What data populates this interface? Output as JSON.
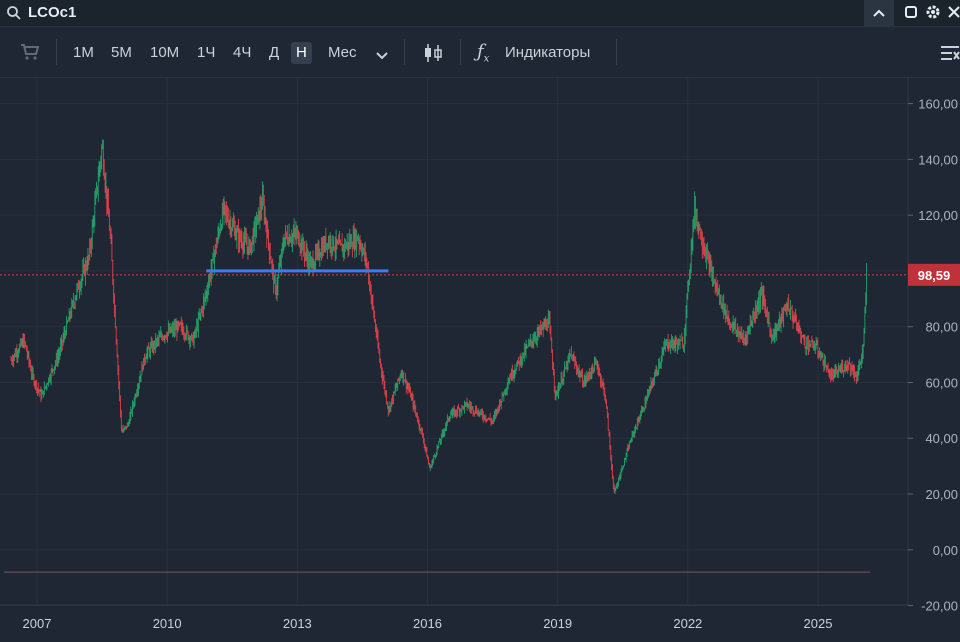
{
  "header": {
    "symbol": "LCOc1"
  },
  "toolbar": {
    "intervals": [
      "1М",
      "5М",
      "10М",
      "1Ч",
      "4Ч",
      "Д",
      "Н",
      "Мес"
    ],
    "active_interval": "Н",
    "indicators_label": "Индикаторы"
  },
  "colors": {
    "background": "#1e2733",
    "up": "#26a269",
    "down": "#e0404a",
    "price_line": "#e0404a",
    "price_tag": "#c0313a",
    "trendline": "#3d7bf0"
  },
  "chart_data": {
    "type": "candlestick",
    "symbol": "LCOc1",
    "timeframe": "Н",
    "x_ticks": [
      "2007",
      "2010",
      "2013",
      "2016",
      "2019",
      "2022",
      "2025"
    ],
    "y_ticks": [
      "160,00",
      "140,00",
      "120,00",
      "100,00",
      "80,00",
      "60,00",
      "40,00",
      "20,00",
      "0,00",
      "-20,00"
    ],
    "ylim": [
      -20,
      165
    ],
    "xlim": [
      2006.3,
      2026.6
    ],
    "last_price": 98.59,
    "last_price_label": "98,59",
    "price_path": [
      [
        2006.4,
        68
      ],
      [
        2006.7,
        75
      ],
      [
        2006.9,
        62
      ],
      [
        2007.1,
        55
      ],
      [
        2007.5,
        70
      ],
      [
        2007.9,
        92
      ],
      [
        2008.2,
        105
      ],
      [
        2008.5,
        145
      ],
      [
        2008.7,
        110
      ],
      [
        2008.95,
        42
      ],
      [
        2009.1,
        45
      ],
      [
        2009.5,
        70
      ],
      [
        2009.9,
        77
      ],
      [
        2010.3,
        80
      ],
      [
        2010.6,
        75
      ],
      [
        2010.9,
        92
      ],
      [
        2011.3,
        122
      ],
      [
        2011.6,
        113
      ],
      [
        2011.9,
        108
      ],
      [
        2012.2,
        125
      ],
      [
        2012.5,
        92
      ],
      [
        2012.7,
        112
      ],
      [
        2013.0,
        113
      ],
      [
        2013.3,
        102
      ],
      [
        2013.7,
        111
      ],
      [
        2014.0,
        108
      ],
      [
        2014.4,
        112
      ],
      [
        2014.6,
        103
      ],
      [
        2014.9,
        68
      ],
      [
        2015.1,
        50
      ],
      [
        2015.4,
        64
      ],
      [
        2015.6,
        56
      ],
      [
        2015.9,
        40
      ],
      [
        2016.05,
        29
      ],
      [
        2016.5,
        48
      ],
      [
        2016.9,
        52
      ],
      [
        2017.5,
        46
      ],
      [
        2017.9,
        62
      ],
      [
        2018.4,
        75
      ],
      [
        2018.8,
        82
      ],
      [
        2018.95,
        55
      ],
      [
        2019.3,
        70
      ],
      [
        2019.6,
        60
      ],
      [
        2019.9,
        67
      ],
      [
        2020.1,
        55
      ],
      [
        2020.3,
        20
      ],
      [
        2020.7,
        40
      ],
      [
        2021.0,
        52
      ],
      [
        2021.5,
        74
      ],
      [
        2021.9,
        74
      ],
      [
        2022.15,
        122
      ],
      [
        2022.35,
        110
      ],
      [
        2022.6,
        96
      ],
      [
        2022.95,
        82
      ],
      [
        2023.3,
        75
      ],
      [
        2023.7,
        92
      ],
      [
        2023.95,
        76
      ],
      [
        2024.3,
        88
      ],
      [
        2024.7,
        74
      ],
      [
        2024.95,
        73
      ],
      [
        2025.3,
        62
      ],
      [
        2025.7,
        67
      ],
      [
        2025.9,
        62
      ],
      [
        2026.05,
        73
      ],
      [
        2026.12,
        98.59
      ]
    ],
    "annotations": {
      "trendline": {
        "from": [
          2010.9,
          100
        ],
        "to": [
          2015.1,
          100
        ]
      },
      "horizontal_line_y": -8
    },
    "grid": true
  }
}
